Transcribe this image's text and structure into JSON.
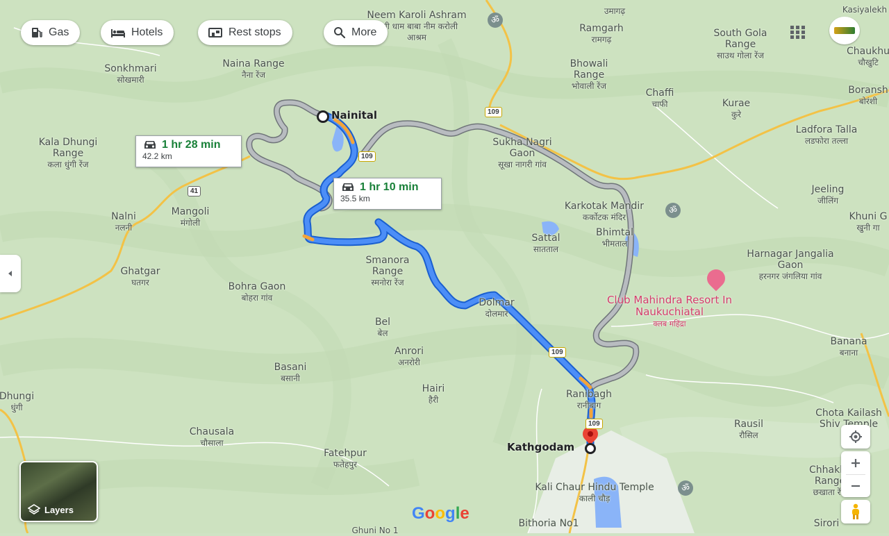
{
  "toolbar": {
    "chips": [
      {
        "label": "Gas",
        "icon": "gas-station-icon"
      },
      {
        "label": "Hotels",
        "icon": "bed-icon"
      },
      {
        "label": "Rest stops",
        "icon": "rest-stop-icon"
      },
      {
        "label": "More",
        "icon": "search-icon"
      }
    ]
  },
  "routes": {
    "primary": {
      "time": "1 hr 10 min",
      "distance": "35.5 km"
    },
    "alternate": {
      "time": "1 hr 28 min",
      "distance": "42.2 km"
    }
  },
  "endpoints": {
    "origin": "Nainital",
    "destination": "Kathgodam"
  },
  "highway_shields": [
    "109",
    "109",
    "109",
    "109",
    "41"
  ],
  "places": [
    {
      "name": "Neem Karoli Ashram",
      "sub": "कैंची धाम बाबा नीम करोली आश्रम"
    },
    {
      "name": "उमागढ़",
      "sub": ""
    },
    {
      "name": "Ramgarh",
      "sub": "रामगढ़"
    },
    {
      "name": "South Gola Range",
      "sub": "साउथ गोला रेंज"
    },
    {
      "name": "Kasiyalekh",
      "sub": ""
    },
    {
      "name": "Chaukhu",
      "sub": "चौखुटि"
    },
    {
      "name": "Sonkhmari",
      "sub": "सोखमारी"
    },
    {
      "name": "Naina Range",
      "sub": "नैना रेंज"
    },
    {
      "name": "Bhowali Range",
      "sub": "भोवाली रेंज"
    },
    {
      "name": "Chaffi",
      "sub": "चाफी"
    },
    {
      "name": "Kurae",
      "sub": "कुरे"
    },
    {
      "name": "Boransh",
      "sub": "बोरंशी"
    },
    {
      "name": "Ladfora Talla",
      "sub": "लडफोरा तल्ला"
    },
    {
      "name": "Kala Dhungi Range",
      "sub": "कला धुंगी रेंज"
    },
    {
      "name": "Sukha Nagri Gaon",
      "sub": "सूखा नागरी गांव"
    },
    {
      "name": "Jeeling",
      "sub": "जीलिंग"
    },
    {
      "name": "Mangoli",
      "sub": "मंगोली"
    },
    {
      "name": "Nalni",
      "sub": "नलनी"
    },
    {
      "name": "Karkotak Mandir",
      "sub": "कर्कोटक मंदिर"
    },
    {
      "name": "Khuni G",
      "sub": "खुनी गा"
    },
    {
      "name": "Sattal",
      "sub": "सातताल"
    },
    {
      "name": "Bhimtal",
      "sub": "भीमताल"
    },
    {
      "name": "Harnagar Jangalia Gaon",
      "sub": "हरनगर जंगलिया गांव"
    },
    {
      "name": "Smanora Range",
      "sub": "स्मनोरा रेंज"
    },
    {
      "name": "Ghatgar",
      "sub": "घतगर"
    },
    {
      "name": "Bohra Gaon",
      "sub": "बोहरा गांव"
    },
    {
      "name": "Dolmar",
      "sub": "दोलमार"
    },
    {
      "name": "Bel",
      "sub": "बेल"
    },
    {
      "name": "Anrori",
      "sub": "अनरोरी"
    },
    {
      "name": "Basani",
      "sub": "बसानी"
    },
    {
      "name": "Banana",
      "sub": "बनाना"
    },
    {
      "name": "Hairi",
      "sub": "हैरी"
    },
    {
      "name": "Ranibagh",
      "sub": "रानीबाग"
    },
    {
      "name": "Dhungi",
      "sub": "धुंगी"
    },
    {
      "name": "Chota Kailash Shiv Temple",
      "sub": ""
    },
    {
      "name": "Rausil",
      "sub": "रौसिल"
    },
    {
      "name": "Chausala",
      "sub": "चौसाला"
    },
    {
      "name": "Fatehpur",
      "sub": "फतेहपुर"
    },
    {
      "name": "Chhakhata Range",
      "sub": "छखाता रेंज"
    },
    {
      "name": "Kali Chaur Hindu Temple",
      "sub": "काली चौड़"
    },
    {
      "name": "Bithoria No1",
      "sub": ""
    },
    {
      "name": "Ghuni No 1",
      "sub": ""
    },
    {
      "name": "Sirori",
      "sub": ""
    }
  ],
  "poi": {
    "name": "Club Mahindra Resort In Naukuchiatal",
    "sub": "क्लब महिंद्रा"
  },
  "layers_label": "Layers",
  "google_logo": "Google",
  "colors": {
    "route_primary": "#4285f4",
    "route_alt": "#9aa0a6",
    "traffic": "#f2a43a",
    "terrain": "#cfe3c4"
  }
}
